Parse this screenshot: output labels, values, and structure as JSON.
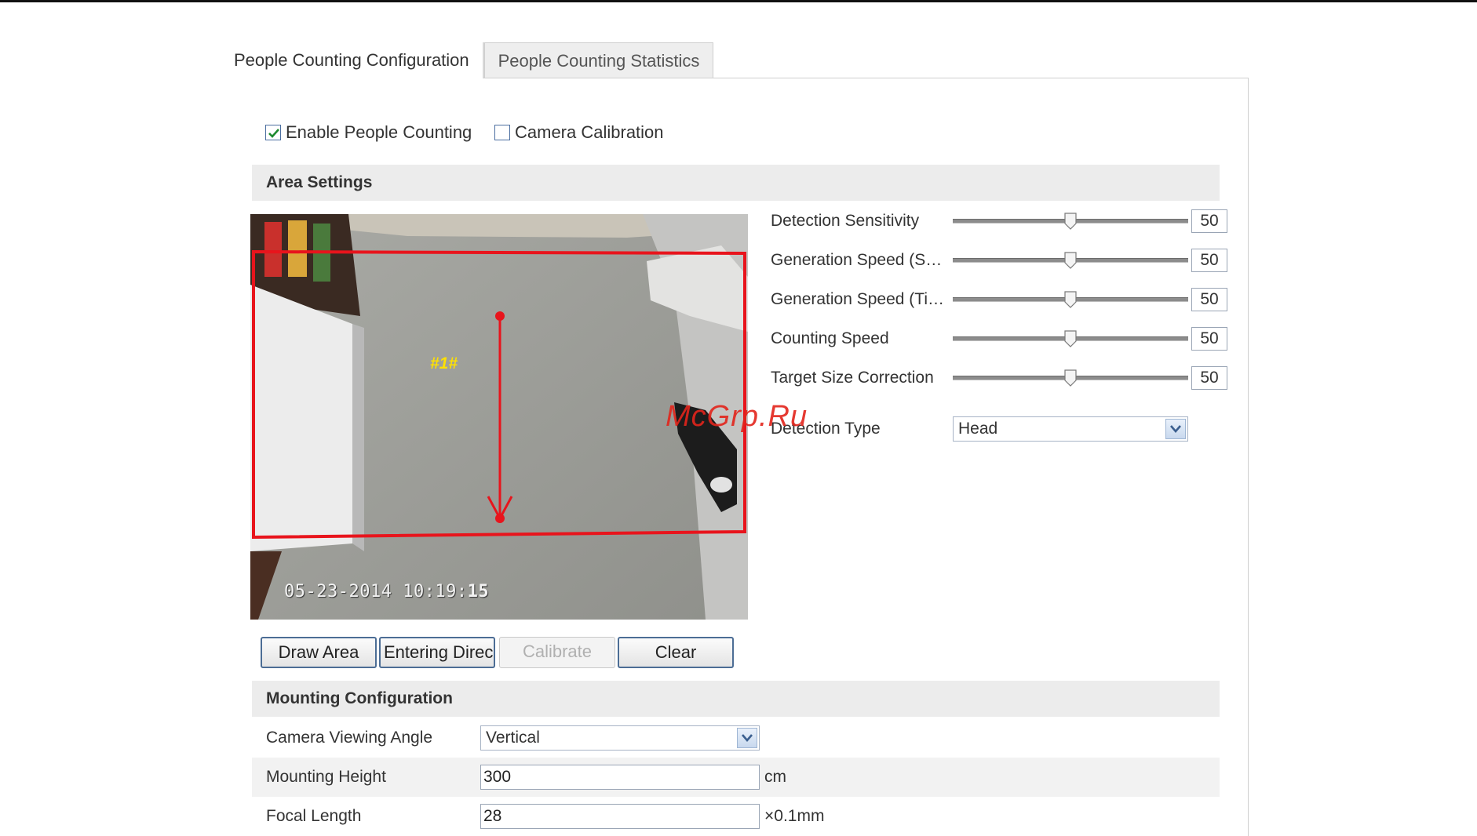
{
  "tabs": [
    {
      "label": "People Counting Configuration",
      "active": true
    },
    {
      "label": "People Counting Statistics",
      "active": false
    }
  ],
  "checkboxes": {
    "enable_people_counting": {
      "label": "Enable People Counting",
      "checked": true
    },
    "camera_calibration": {
      "label": "Camera Calibration",
      "checked": false
    }
  },
  "area_settings": {
    "title": "Area Settings",
    "video": {
      "timestamp_main": "05-23-2014 10:19:",
      "timestamp_seconds": "15",
      "area_label": "#1#",
      "area_color": "#e8141c"
    },
    "sliders": [
      {
        "label": "Detection Sensitivity",
        "value": "50",
        "level": 50
      },
      {
        "label": "Generation Speed (S…",
        "value": "50",
        "level": 50
      },
      {
        "label": "Generation Speed (Ti…",
        "value": "50",
        "level": 50
      },
      {
        "label": "Counting Speed",
        "value": "50",
        "level": 50
      },
      {
        "label": "Target Size Correction",
        "value": "50",
        "level": 50
      }
    ],
    "detection_type": {
      "label": "Detection Type",
      "value": "Head"
    },
    "buttons": {
      "draw_area": "Draw Area",
      "entering_direction": "Entering Direc",
      "calibrate": "Calibrate",
      "clear": "Clear"
    }
  },
  "mounting_configuration": {
    "title": "Mounting Configuration",
    "camera_viewing_angle": {
      "label": "Camera Viewing Angle",
      "value": "Vertical"
    },
    "mounting_height": {
      "label": "Mounting Height",
      "value": "300",
      "unit": "cm"
    },
    "focal_length": {
      "label": "Focal Length",
      "value": "28",
      "unit": "×0.1mm"
    }
  },
  "watermark": "McGrp.Ru",
  "colors": {
    "accent_border": "#4c6d95",
    "section_bg": "#ececec",
    "overlay_red": "#e8141c"
  }
}
